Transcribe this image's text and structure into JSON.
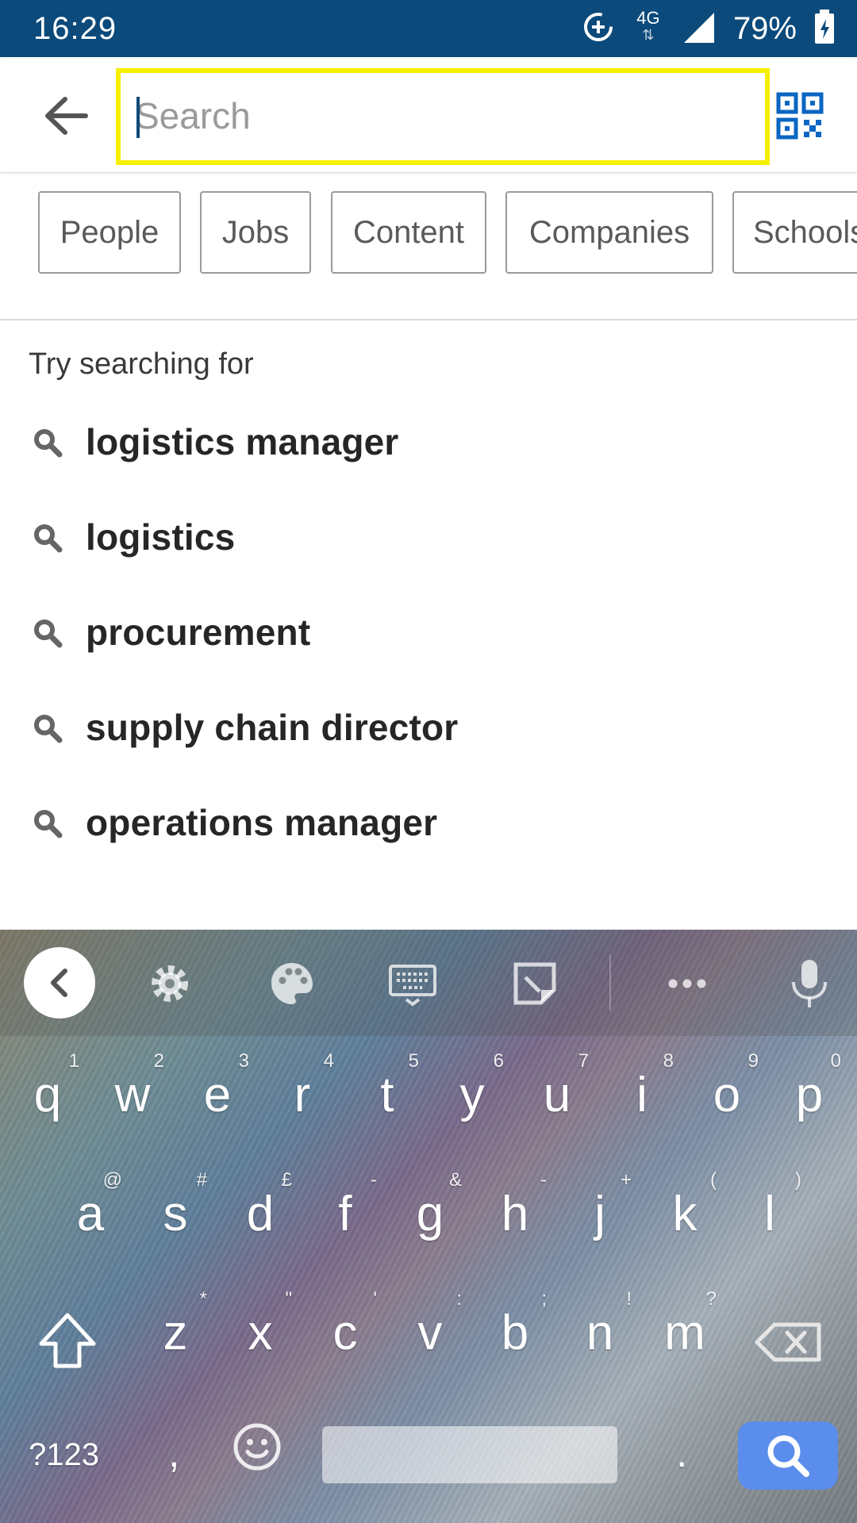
{
  "status_bar": {
    "time": "16:29",
    "network_label": "4G",
    "battery_percent": "79%"
  },
  "search": {
    "placeholder": "Search",
    "value": ""
  },
  "filters": [
    "People",
    "Jobs",
    "Content",
    "Companies",
    "Schools"
  ],
  "suggestions": {
    "title": "Try searching for",
    "items": [
      "logistics manager",
      "logistics",
      "procurement",
      "supply chain director",
      "operations manager"
    ]
  },
  "keyboard": {
    "row1": [
      {
        "key": "q",
        "hint": "1"
      },
      {
        "key": "w",
        "hint": "2"
      },
      {
        "key": "e",
        "hint": "3"
      },
      {
        "key": "r",
        "hint": "4"
      },
      {
        "key": "t",
        "hint": "5"
      },
      {
        "key": "y",
        "hint": "6"
      },
      {
        "key": "u",
        "hint": "7"
      },
      {
        "key": "i",
        "hint": "8"
      },
      {
        "key": "o",
        "hint": "9"
      },
      {
        "key": "p",
        "hint": "0"
      }
    ],
    "row2": [
      {
        "key": "a",
        "hint": "@"
      },
      {
        "key": "s",
        "hint": "#"
      },
      {
        "key": "d",
        "hint": "£"
      },
      {
        "key": "f",
        "hint": "-"
      },
      {
        "key": "g",
        "hint": "&"
      },
      {
        "key": "h",
        "hint": "-"
      },
      {
        "key": "j",
        "hint": "+"
      },
      {
        "key": "k",
        "hint": "("
      },
      {
        "key": "l",
        "hint": ")"
      }
    ],
    "row3": [
      {
        "key": "z",
        "hint": "*"
      },
      {
        "key": "x",
        "hint": "\""
      },
      {
        "key": "c",
        "hint": "'"
      },
      {
        "key": "v",
        "hint": ":"
      },
      {
        "key": "b",
        "hint": ";"
      },
      {
        "key": "n",
        "hint": "!"
      },
      {
        "key": "m",
        "hint": "?"
      }
    ],
    "symbols_label": "?123",
    "comma": ",",
    "period": "."
  },
  "colors": {
    "status_bar": "#0b4a7b",
    "highlight": "#f5ef00",
    "brand_blue": "#0a66c2",
    "search_key": "#5a8dec"
  },
  "icons": [
    "back-arrow-icon",
    "qr-code-icon",
    "search-icon",
    "gear-icon",
    "palette-icon",
    "keyboard-icon",
    "sticker-icon",
    "more-icon",
    "microphone-icon",
    "shift-icon",
    "backspace-icon",
    "emoji-icon"
  ]
}
